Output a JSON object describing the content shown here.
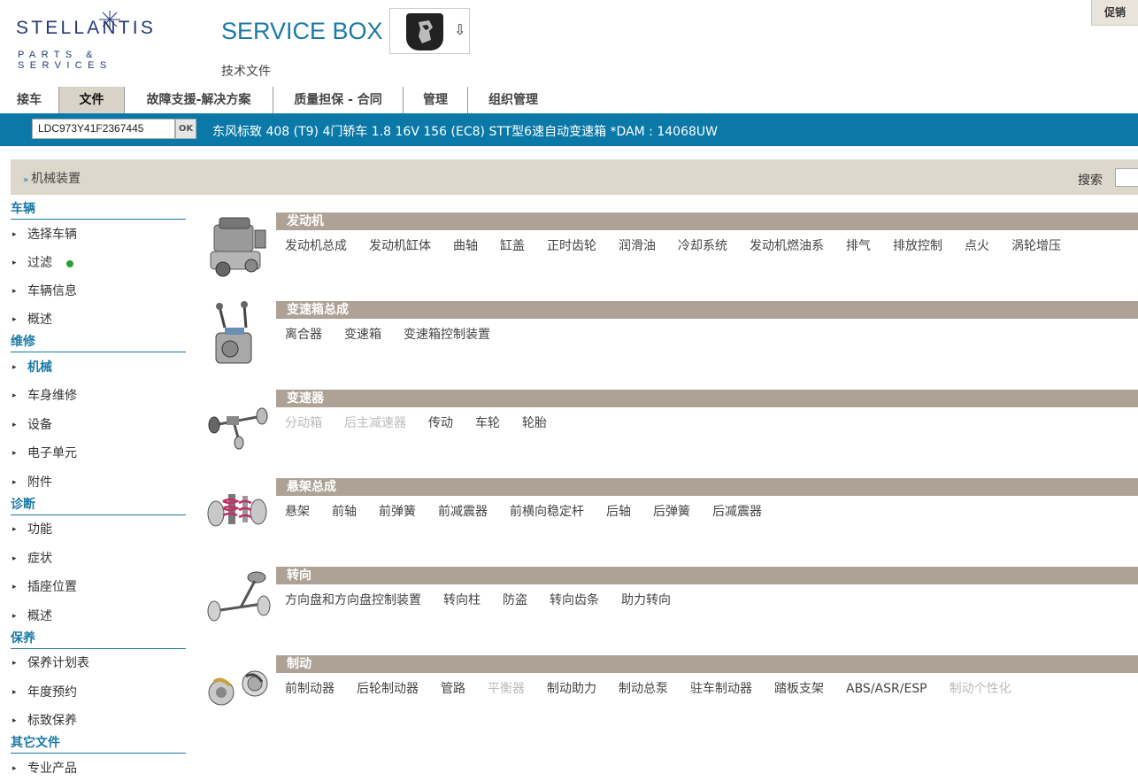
{
  "header": {
    "logo_text": "STELLANTIS",
    "logo_sub": "PARTS & SERVICES",
    "app_title": "SERVICE BOX",
    "subtitle": "技术文件",
    "logout_label": "促销"
  },
  "tabs": [
    {
      "label": "接车",
      "active": false
    },
    {
      "label": "文件",
      "active": true
    },
    {
      "label": "故障支援-解决方案",
      "active": false
    },
    {
      "label": "质量担保 - 合同",
      "active": false
    },
    {
      "label": "管理",
      "active": false
    },
    {
      "label": "组织管理",
      "active": false
    }
  ],
  "vehicle": {
    "vin": "LDC973Y41F2367445",
    "ok_label": "OK",
    "description": "东风标致 408 (T9) 4门轿车 1.8 16V 156 (EC8) STT型6速自动变速箱 *DAM : 14068UW"
  },
  "breadcrumb": {
    "current": "机械装置",
    "search_label": "搜索"
  },
  "sidebar": {
    "groups": [
      {
        "title": "车辆",
        "items": [
          "选择车辆",
          "过滤",
          "车辆信息",
          "概述"
        ]
      },
      {
        "title": "维修",
        "items": [
          "机械",
          "车身维修",
          "设备",
          "电子单元",
          "附件"
        ]
      },
      {
        "title": "诊断",
        "items": [
          "功能",
          "症状",
          "插座位置",
          "概述"
        ]
      },
      {
        "title": "保养",
        "items": [
          "保养计划表",
          "年度预约",
          "标致保养"
        ]
      },
      {
        "title": "其它文件",
        "items": [
          "专业产品"
        ]
      }
    ],
    "active_item": "机械",
    "filter_status_color": "#2e9a3a"
  },
  "sections": [
    {
      "title": "发动机",
      "image": "engine-icon",
      "links": [
        {
          "label": "发动机总成",
          "enabled": true
        },
        {
          "label": "发动机缸体",
          "enabled": true
        },
        {
          "label": "曲轴",
          "enabled": true
        },
        {
          "label": "缸盖",
          "enabled": true
        },
        {
          "label": "正时齿轮",
          "enabled": true
        },
        {
          "label": "润滑油",
          "enabled": true
        },
        {
          "label": "冷却系统",
          "enabled": true
        },
        {
          "label": "发动机燃油系",
          "enabled": true
        },
        {
          "label": "排气",
          "enabled": true
        },
        {
          "label": "排放控制",
          "enabled": true
        },
        {
          "label": "点火",
          "enabled": true
        },
        {
          "label": "涡轮增压",
          "enabled": true
        }
      ]
    },
    {
      "title": "变速箱总成",
      "image": "gearbox-icon",
      "links": [
        {
          "label": "离合器",
          "enabled": true
        },
        {
          "label": "变速箱",
          "enabled": true
        },
        {
          "label": "变速箱控制装置",
          "enabled": true
        }
      ]
    },
    {
      "title": "变速器",
      "image": "drivetrain-icon",
      "links": [
        {
          "label": "分动箱",
          "enabled": false
        },
        {
          "label": "后主减速器",
          "enabled": false
        },
        {
          "label": "传动",
          "enabled": true
        },
        {
          "label": "车轮",
          "enabled": true
        },
        {
          "label": "轮胎",
          "enabled": true
        }
      ]
    },
    {
      "title": "悬架总成",
      "image": "suspension-icon",
      "links": [
        {
          "label": "悬架",
          "enabled": true
        },
        {
          "label": "前轴",
          "enabled": true
        },
        {
          "label": "前弹簧",
          "enabled": true
        },
        {
          "label": "前减震器",
          "enabled": true
        },
        {
          "label": "前横向稳定杆",
          "enabled": true
        },
        {
          "label": "后轴",
          "enabled": true
        },
        {
          "label": "后弹簧",
          "enabled": true
        },
        {
          "label": "后减震器",
          "enabled": true
        }
      ]
    },
    {
      "title": "转向",
      "image": "steering-icon",
      "links": [
        {
          "label": "方向盘和方向盘控制装置",
          "enabled": true
        },
        {
          "label": "转向柱",
          "enabled": true
        },
        {
          "label": "防盗",
          "enabled": true
        },
        {
          "label": "转向齿条",
          "enabled": true
        },
        {
          "label": "助力转向",
          "enabled": true
        }
      ]
    },
    {
      "title": "制动",
      "image": "brake-icon",
      "links": [
        {
          "label": "前制动器",
          "enabled": true
        },
        {
          "label": "后轮制动器",
          "enabled": true
        },
        {
          "label": "管路",
          "enabled": true
        },
        {
          "label": "平衡器",
          "enabled": false
        },
        {
          "label": "制动助力",
          "enabled": true
        },
        {
          "label": "制动总泵",
          "enabled": true
        },
        {
          "label": "驻车制动器",
          "enabled": true
        },
        {
          "label": "踏板支架",
          "enabled": true
        },
        {
          "label": "ABS/ASR/ESP",
          "enabled": true
        },
        {
          "label": "制动个性化",
          "enabled": false
        }
      ]
    }
  ],
  "colors": {
    "accent_blue": "#0b79a8",
    "section_header": "#aea296",
    "breadcrumb_bg": "#dcd8cb"
  }
}
